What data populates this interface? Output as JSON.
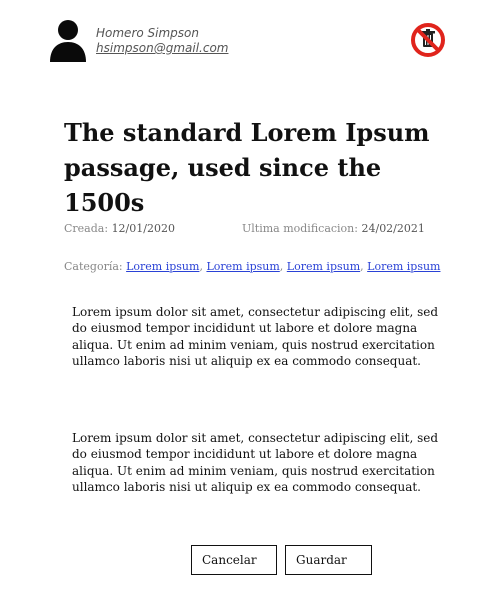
{
  "user": {
    "name": "Homero Simpson",
    "email": "hsimpson@gmail.com",
    "avatar_icon": "user-silhouette-icon"
  },
  "actions": {
    "delete_icon": "no-trash-icon",
    "delete_color": "#e0241c"
  },
  "article": {
    "title": "The standard Lorem Ipsum passage, used since the 1500s",
    "created_label": "Creada:",
    "created_date": "12/01/2020",
    "modified_label": "Ultima modificacion:",
    "modified_date": "24/02/2021",
    "category_label": "Categoría:",
    "categories": [
      "Lorem ipsum",
      "Lorem ipsum",
      "Lorem ipsum",
      "Lorem ipsum"
    ],
    "paragraphs": [
      "Lorem ipsum dolor sit amet, consectetur adipiscing elit, sed do eiusmod tempor incididunt ut labore et dolore magna aliqua. Ut enim ad minim veniam, quis nostrud exercitation ullamco laboris nisi ut aliquip ex ea commodo consequat.",
      "Lorem ipsum dolor sit amet, consectetur adipiscing elit, sed do eiusmod tempor incididunt ut labore et dolore magna aliqua. Ut enim ad minim veniam, quis nostrud exercitation ullamco laboris nisi ut aliquip ex ea commodo consequat."
    ]
  },
  "buttons": {
    "cancel_label": "Cancelar",
    "save_label": "Guardar"
  },
  "colors": {
    "link": "#2a42d6",
    "meta_text": "#888888"
  }
}
